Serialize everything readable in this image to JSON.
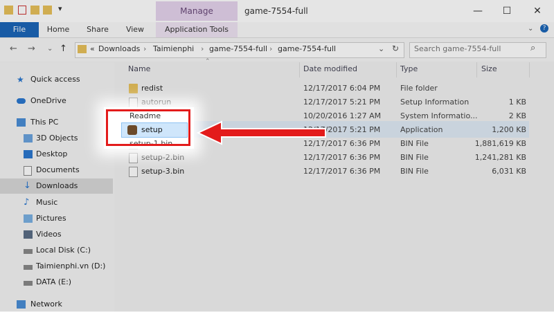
{
  "window": {
    "title": "game-7554-full",
    "manage_label": "Manage",
    "minimize": "—",
    "maximize": "☐",
    "close": "✕"
  },
  "ribbon": {
    "tabs": [
      "File",
      "Home",
      "Share",
      "View",
      "Application Tools"
    ]
  },
  "address": {
    "overflow": "«",
    "crumbs": [
      "Downloads",
      "Taimienphi",
      "game-7554-full",
      "game-7554-full"
    ],
    "search_placeholder": "Search game-7554-full"
  },
  "nav": {
    "items": [
      {
        "label": "Quick access"
      },
      {
        "label": "OneDrive"
      },
      {
        "label": "This PC"
      },
      {
        "label": "3D Objects"
      },
      {
        "label": "Desktop"
      },
      {
        "label": "Documents"
      },
      {
        "label": "Downloads"
      },
      {
        "label": "Music"
      },
      {
        "label": "Pictures"
      },
      {
        "label": "Videos"
      },
      {
        "label": "Local Disk (C:)"
      },
      {
        "label": "Taimienphi.vn (D:)"
      },
      {
        "label": "DATA (E:)"
      },
      {
        "label": "Network"
      }
    ]
  },
  "columns": {
    "name": "Name",
    "date": "Date modified",
    "type": "Type",
    "size": "Size"
  },
  "files": [
    {
      "name": "redist",
      "date": "12/17/2017 6:04 PM",
      "type": "File folder",
      "size": "",
      "icon": "folder-icon"
    },
    {
      "name": "autorun",
      "date": "12/17/2017 5:21 PM",
      "type": "Setup Information",
      "size": "1 KB",
      "icon": "setup-info-icon"
    },
    {
      "name": "Readme",
      "date": "10/20/2016 1:27 AM",
      "type": "System Informatio...",
      "size": "2 KB",
      "icon": "system-info-icon"
    },
    {
      "name": "setup",
      "date": "12/17/2017 5:21 PM",
      "type": "Application",
      "size": "1,200 KB",
      "icon": "application-icon"
    },
    {
      "name": "setup-1.bin",
      "date": "12/17/2017 6:36 PM",
      "type": "BIN File",
      "size": "1,881,619 KB",
      "icon": "file-icon"
    },
    {
      "name": "setup-2.bin",
      "date": "12/17/2017 6:36 PM",
      "type": "BIN File",
      "size": "1,241,281 KB",
      "icon": "file-icon"
    },
    {
      "name": "setup-3.bin",
      "date": "12/17/2017 6:36 PM",
      "type": "BIN File",
      "size": "6,031 KB",
      "icon": "file-icon"
    }
  ],
  "colors": {
    "highlight_border": "#e31b1b",
    "arrow": "#e31b1b",
    "file_tab": "#1b66b8"
  }
}
